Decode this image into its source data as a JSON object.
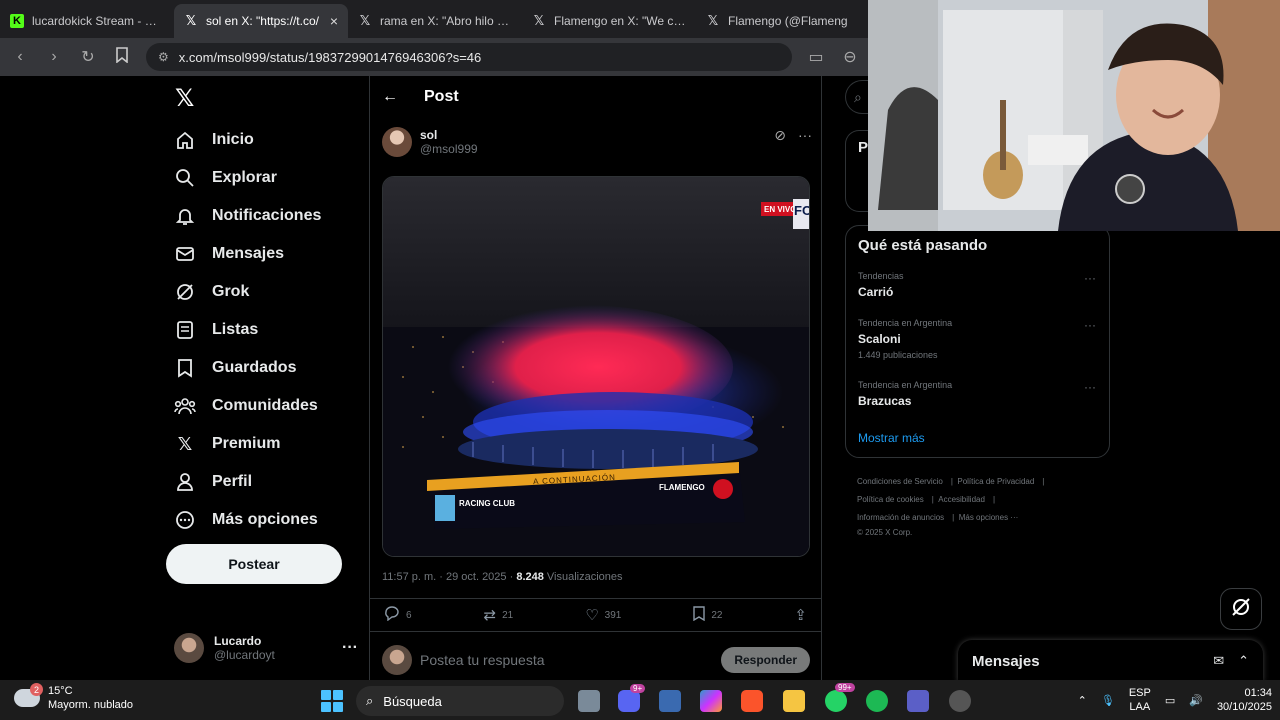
{
  "browser": {
    "tabs": [
      {
        "title": "lucardokick Stream - Watch",
        "icon": "kick-icon",
        "active": false
      },
      {
        "title": "sol en X: \"https://t.co/",
        "icon": "x-icon",
        "active": true
      },
      {
        "title": "rama en X: \"Abro hilo dem",
        "icon": "x-icon",
        "active": false
      },
      {
        "title": "Flamengo en X: \"We can n",
        "icon": "x-icon",
        "active": false
      },
      {
        "title": "Flamengo (@Flameng",
        "icon": "x-icon",
        "active": false
      }
    ],
    "url": "x.com/msol999/status/1983729901476946306?s=46"
  },
  "sidebar": {
    "items": [
      {
        "label": "Inicio",
        "icon": "home-icon"
      },
      {
        "label": "Explorar",
        "icon": "search-icon"
      },
      {
        "label": "Notificaciones",
        "icon": "bell-icon"
      },
      {
        "label": "Mensajes",
        "icon": "mail-icon"
      },
      {
        "label": "Grok",
        "icon": "grok-icon"
      },
      {
        "label": "Listas",
        "icon": "list-icon"
      },
      {
        "label": "Guardados",
        "icon": "bookmark-icon"
      },
      {
        "label": "Comunidades",
        "icon": "communities-icon"
      },
      {
        "label": "Premium",
        "icon": "x-icon"
      },
      {
        "label": "Perfil",
        "icon": "person-icon"
      },
      {
        "label": "Más opciones",
        "icon": "more-circle-icon"
      }
    ],
    "post_button": "Postear",
    "account": {
      "name": "Lucardo",
      "handle": "@lucardoyt"
    }
  },
  "post": {
    "header": "Post",
    "author": {
      "name": "sol",
      "handle": "@msol999"
    },
    "media_overlay": {
      "live_badge": "EN VIVO",
      "channel": "FO",
      "banner": "A CONTINUACIÓN",
      "team_left": "RACING CLUB",
      "team_right": "FLAMENGO"
    },
    "timestamp": "11:57 p. m. · 29 oct. 2025 · ",
    "views": "8.248",
    "views_label": " Visualizaciones",
    "stats": {
      "replies": "6",
      "reposts": "21",
      "likes": "391",
      "bookmarks": "22"
    },
    "reply_placeholder": "Postea tu respuesta",
    "reply_button": "Responder"
  },
  "right": {
    "premium_initial": "P",
    "trends_title": "Qué está pasando",
    "trends": [
      {
        "context": "Tendencias",
        "name": "Carrió",
        "posts": ""
      },
      {
        "context": "Tendencia en Argentina",
        "name": "Scaloni",
        "posts": "1.449 publicaciones"
      },
      {
        "context": "Tendencia en Argentina",
        "name": "Brazucas",
        "posts": ""
      }
    ],
    "show_more": "Mostrar más",
    "footer": {
      "line1a": "Condiciones de Servicio",
      "line1b": "Política de Privacidad",
      "line2a": "Política de cookies",
      "line2b": "Accesibilidad",
      "line3a": "Información de anuncios",
      "line3b": "Más opciones ···",
      "copyright": "© 2025 X Corp."
    },
    "messages_dock": "Mensajes"
  },
  "taskbar": {
    "weather_temp": "15°C",
    "weather_desc": "Mayorm. nublado",
    "weather_badge": "2",
    "search_label": "Búsqueda",
    "lang_top": "ESP",
    "lang_bottom": "LAA",
    "time": "01:34",
    "date": "30/10/2025",
    "badge_discord": "9+",
    "badge_whatsapp": "99+"
  },
  "colors": {
    "background": "#000000",
    "accent": "#1d9bf0",
    "border": "#2f3336",
    "muted": "#71767b"
  }
}
